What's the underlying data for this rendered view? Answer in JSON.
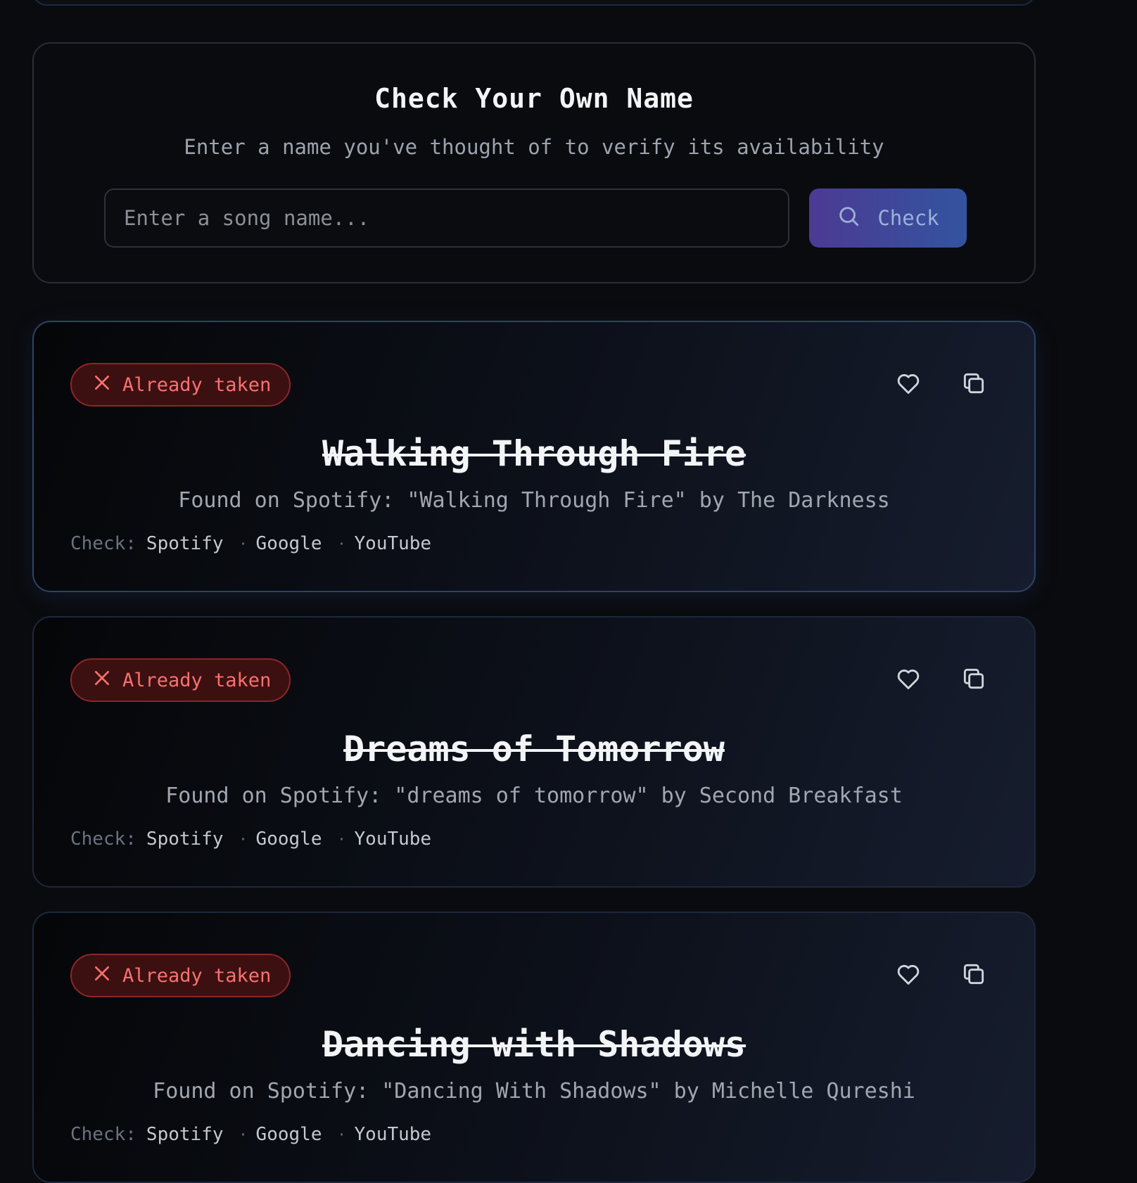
{
  "check_panel": {
    "title": "Check Your Own Name",
    "subtitle": "Enter a name you've thought of to verify its availability",
    "input_placeholder": "Enter a song name...",
    "input_value": "",
    "button_label": "Check"
  },
  "colors": {
    "background": "#0a0b0e",
    "button_gradient_start": "#4c3a93",
    "button_gradient_end": "#33549f",
    "taken_badge_text": "#f87171",
    "taken_badge_border": "#8c2626"
  },
  "results": [
    {
      "badge": "Already taken",
      "name": "Walking Through Fire",
      "found": "Found on Spotify: \"Walking Through Fire\" by The Darkness",
      "check_label": "Check:",
      "links": [
        "Spotify",
        "Google",
        "YouTube"
      ]
    },
    {
      "badge": "Already taken",
      "name": "Dreams of Tomorrow",
      "found": "Found on Spotify: \"dreams of tomorrow\" by Second Breakfast",
      "check_label": "Check:",
      "links": [
        "Spotify",
        "Google",
        "YouTube"
      ]
    },
    {
      "badge": "Already taken",
      "name": "Dancing with Shadows",
      "found": "Found on Spotify: \"Dancing With Shadows\" by Michelle Qureshi",
      "check_label": "Check:",
      "links": [
        "Spotify",
        "Google",
        "YouTube"
      ]
    }
  ],
  "icons": {
    "badge": "x-icon",
    "favorite": "heart-icon",
    "copy": "copy-icon",
    "check_button": "search-icon"
  }
}
